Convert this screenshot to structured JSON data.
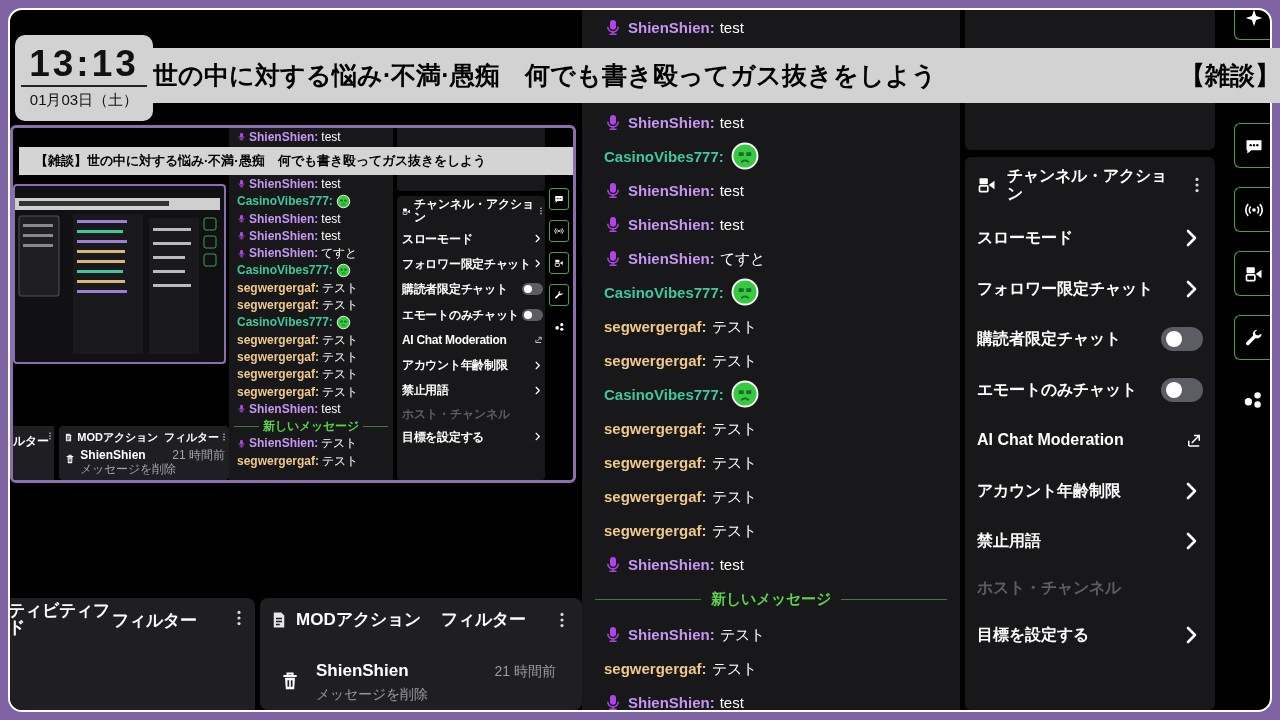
{
  "clock": {
    "time": "13:13",
    "date": "01月03日（土）"
  },
  "title_bar": {
    "text": "世の中に対する悩み·不満·愚痴　何でも書き殴ってガス抜きをしよう",
    "next_text": "【雑談】"
  },
  "chat": {
    "rows": [
      {
        "kind": "message",
        "user": "ShienShien:",
        "color": "#c597f3",
        "broadcaster": true,
        "text": "test"
      },
      {
        "kind": "message",
        "user": "ShienShien:",
        "color": "#c597f3",
        "broadcaster": true,
        "text": "test"
      },
      {
        "kind": "emote",
        "user": "CasinoVibes777:",
        "color": "#3ec99a",
        "broadcaster": false
      },
      {
        "kind": "message",
        "user": "ShienShien:",
        "color": "#c597f3",
        "broadcaster": true,
        "text": "test"
      },
      {
        "kind": "message",
        "user": "ShienShien:",
        "color": "#c597f3",
        "broadcaster": true,
        "text": "test"
      },
      {
        "kind": "message",
        "user": "ShienShien:",
        "color": "#c597f3",
        "broadcaster": true,
        "text": "てすと"
      },
      {
        "kind": "emote",
        "user": "CasinoVibes777:",
        "color": "#3ec99a",
        "broadcaster": false
      },
      {
        "kind": "message",
        "user": "segwergergaf:",
        "color": "#f0c98a",
        "broadcaster": false,
        "text": "テスト"
      },
      {
        "kind": "message",
        "user": "segwergergaf:",
        "color": "#f0c98a",
        "broadcaster": false,
        "text": "テスト"
      },
      {
        "kind": "emote",
        "user": "CasinoVibes777:",
        "color": "#3ec99a",
        "broadcaster": false
      },
      {
        "kind": "message",
        "user": "segwergergaf:",
        "color": "#f0c98a",
        "broadcaster": false,
        "text": "テスト"
      },
      {
        "kind": "message",
        "user": "segwergergaf:",
        "color": "#f0c98a",
        "broadcaster": false,
        "text": "テスト"
      },
      {
        "kind": "message",
        "user": "segwergergaf:",
        "color": "#f0c98a",
        "broadcaster": false,
        "text": "テスト"
      },
      {
        "kind": "message",
        "user": "segwergergaf:",
        "color": "#f0c98a",
        "broadcaster": false,
        "text": "テスト"
      },
      {
        "kind": "message",
        "user": "ShienShien:",
        "color": "#c597f3",
        "broadcaster": true,
        "text": "test"
      },
      {
        "kind": "divider",
        "text": "新しいメッセージ"
      },
      {
        "kind": "message",
        "user": "ShienShien:",
        "color": "#c597f3",
        "broadcaster": true,
        "text": "テスト"
      },
      {
        "kind": "message",
        "user": "segwergergaf:",
        "color": "#f0c98a",
        "broadcaster": false,
        "text": "テスト"
      },
      {
        "kind": "message",
        "user": "ShienShien:",
        "color": "#c597f3",
        "broadcaster": true,
        "text": "test"
      }
    ]
  },
  "channel_actions": {
    "title": "チャンネル・アクション",
    "items": [
      {
        "label": "スローモード",
        "kind": "submenu",
        "disabled": false
      },
      {
        "label": "フォロワー限定チャット",
        "kind": "submenu",
        "disabled": false
      },
      {
        "label": "購読者限定チャット",
        "kind": "toggle",
        "on": false,
        "disabled": false
      },
      {
        "label": "エモートのみチャット",
        "kind": "toggle",
        "on": false,
        "disabled": false
      },
      {
        "label": "AI Chat Moderation",
        "kind": "external",
        "disabled": false
      },
      {
        "label": "アカウント年齢制限",
        "kind": "submenu",
        "disabled": false
      },
      {
        "label": "禁止用語",
        "kind": "submenu",
        "disabled": false
      },
      {
        "label": "ホスト・チャンネル",
        "kind": "plain",
        "disabled": true
      },
      {
        "label": "目標を設定する",
        "kind": "submenu",
        "disabled": false
      }
    ]
  },
  "activity_panel": {
    "title": "ティビティフド",
    "filter": "フィルター"
  },
  "mod_panel": {
    "title": "MODアクション",
    "filter": "フィルター",
    "entries": [
      {
        "user": "ShienShien",
        "time": "21 時間前",
        "action": "メッセージを削除"
      }
    ]
  },
  "preview": {
    "title": "【雑談】世の中に対する悩み·不満·愚痴　何でも書き殴ってガス抜きをしよう",
    "chat": {
      "rows": [
        {
          "kind": "message",
          "user": "ShienShien:",
          "color": "#c597f3",
          "broadcaster": true,
          "text": "test"
        },
        {
          "kind": "message",
          "user": "ShienShien:",
          "color": "#c597f3",
          "broadcaster": true,
          "text": "test"
        },
        {
          "kind": "emote",
          "user": "CasinoVibes777:",
          "color": "#3ec99a",
          "broadcaster": false
        },
        {
          "kind": "message",
          "user": "ShienShien:",
          "color": "#c597f3",
          "broadcaster": true,
          "text": "test"
        },
        {
          "kind": "message",
          "user": "ShienShien:",
          "color": "#c597f3",
          "broadcaster": true,
          "text": "test"
        },
        {
          "kind": "message",
          "user": "ShienShien:",
          "color": "#c597f3",
          "broadcaster": true,
          "text": "てすと"
        },
        {
          "kind": "emote",
          "user": "CasinoVibes777:",
          "color": "#3ec99a",
          "broadcaster": false
        },
        {
          "kind": "message",
          "user": "segwergergaf:",
          "color": "#f0c98a",
          "broadcaster": false,
          "text": "テスト"
        },
        {
          "kind": "message",
          "user": "segwergergaf:",
          "color": "#f0c98a",
          "broadcaster": false,
          "text": "テスト"
        },
        {
          "kind": "emote",
          "user": "CasinoVibes777:",
          "color": "#3ec99a",
          "broadcaster": false
        },
        {
          "kind": "message",
          "user": "segwergergaf:",
          "color": "#f0c98a",
          "broadcaster": false,
          "text": "テスト"
        },
        {
          "kind": "message",
          "user": "segwergergaf:",
          "color": "#f0c98a",
          "broadcaster": false,
          "text": "テスト"
        },
        {
          "kind": "message",
          "user": "segwergergaf:",
          "color": "#f0c98a",
          "broadcaster": false,
          "text": "テスト"
        },
        {
          "kind": "message",
          "user": "segwergergaf:",
          "color": "#f0c98a",
          "broadcaster": false,
          "text": "テスト"
        },
        {
          "kind": "message",
          "user": "ShienShien:",
          "color": "#c597f3",
          "broadcaster": true,
          "text": "test"
        },
        {
          "kind": "divider",
          "text": "新しいメッセージ"
        },
        {
          "kind": "message",
          "user": "ShienShien:",
          "color": "#c597f3",
          "broadcaster": true,
          "text": "テスト"
        },
        {
          "kind": "message",
          "user": "segwergergaf:",
          "color": "#f0c98a",
          "broadcaster": false,
          "text": "テスト"
        }
      ]
    },
    "channel_actions": {
      "title": "チャンネル・アクション",
      "items": [
        {
          "label": "スローモード",
          "kind": "submenu",
          "disabled": false
        },
        {
          "label": "フォロワー限定チャット",
          "kind": "submenu",
          "disabled": false
        },
        {
          "label": "購読者限定チャット",
          "kind": "toggle",
          "on": false,
          "disabled": false
        },
        {
          "label": "エモートのみチャット",
          "kind": "toggle",
          "on": false,
          "disabled": false
        },
        {
          "label": "AI Chat Moderation",
          "kind": "external",
          "disabled": false
        },
        {
          "label": "アカウント年齢制限",
          "kind": "submenu",
          "disabled": false
        },
        {
          "label": "禁止用語",
          "kind": "submenu",
          "disabled": false
        },
        {
          "label": "ホスト・チャンネル",
          "kind": "plain",
          "disabled": true
        },
        {
          "label": "目標を設定する",
          "kind": "submenu",
          "disabled": false
        }
      ]
    },
    "activity_panel": {
      "filter": "ルター"
    },
    "mod_panel": {
      "title": "MODアクション",
      "filter": "フィルター",
      "entries": [
        {
          "user": "ShienShien",
          "time": "21 時間前",
          "action": "メッセージを削除"
        }
      ]
    }
  }
}
